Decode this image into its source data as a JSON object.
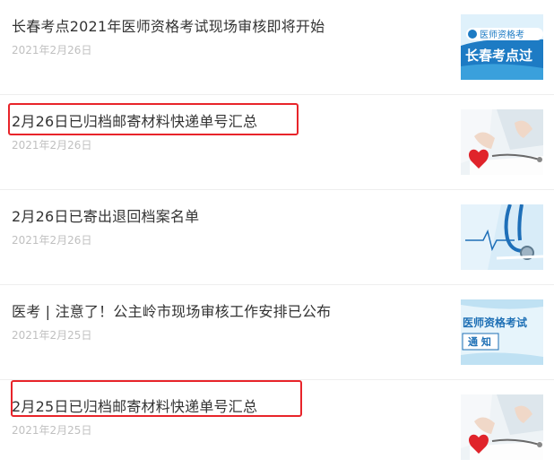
{
  "news": [
    {
      "title": "长春考点2021年医师资格考试现场审核即将开始",
      "date": "2021年2月26日",
      "highlighted": false,
      "thumb": {
        "kind": "banner-changchun",
        "text_top": "医师资格考",
        "text_main": "长春考点过"
      }
    },
    {
      "title": "2月26日已归档邮寄材料快递单号汇总",
      "date": "2021年2月26日",
      "highlighted": true,
      "thumb": {
        "kind": "doctor-heart-stethoscope"
      }
    },
    {
      "title": "2月26日已寄出退回档案名单",
      "date": "2021年2月26日",
      "highlighted": false,
      "thumb": {
        "kind": "stethoscope-blue"
      }
    },
    {
      "title": "医考 | 注意了！公主岭市现场审核工作安排已公布",
      "date": "2021年2月25日",
      "highlighted": false,
      "thumb": {
        "kind": "notice-banner",
        "text_top": "医师资格考试",
        "text_main": "通 知"
      }
    },
    {
      "title": "2月25日已归档邮寄材料快递单号汇总",
      "date": "2021年2月25日",
      "highlighted": true,
      "thumb": {
        "kind": "doctor-heart-stethoscope"
      }
    }
  ],
  "colors": {
    "title": "#333333",
    "date": "#c0c0c0",
    "highlight": "#e8242a",
    "banner_blue": "#1d7bc4",
    "divider": "#eeeeee"
  }
}
